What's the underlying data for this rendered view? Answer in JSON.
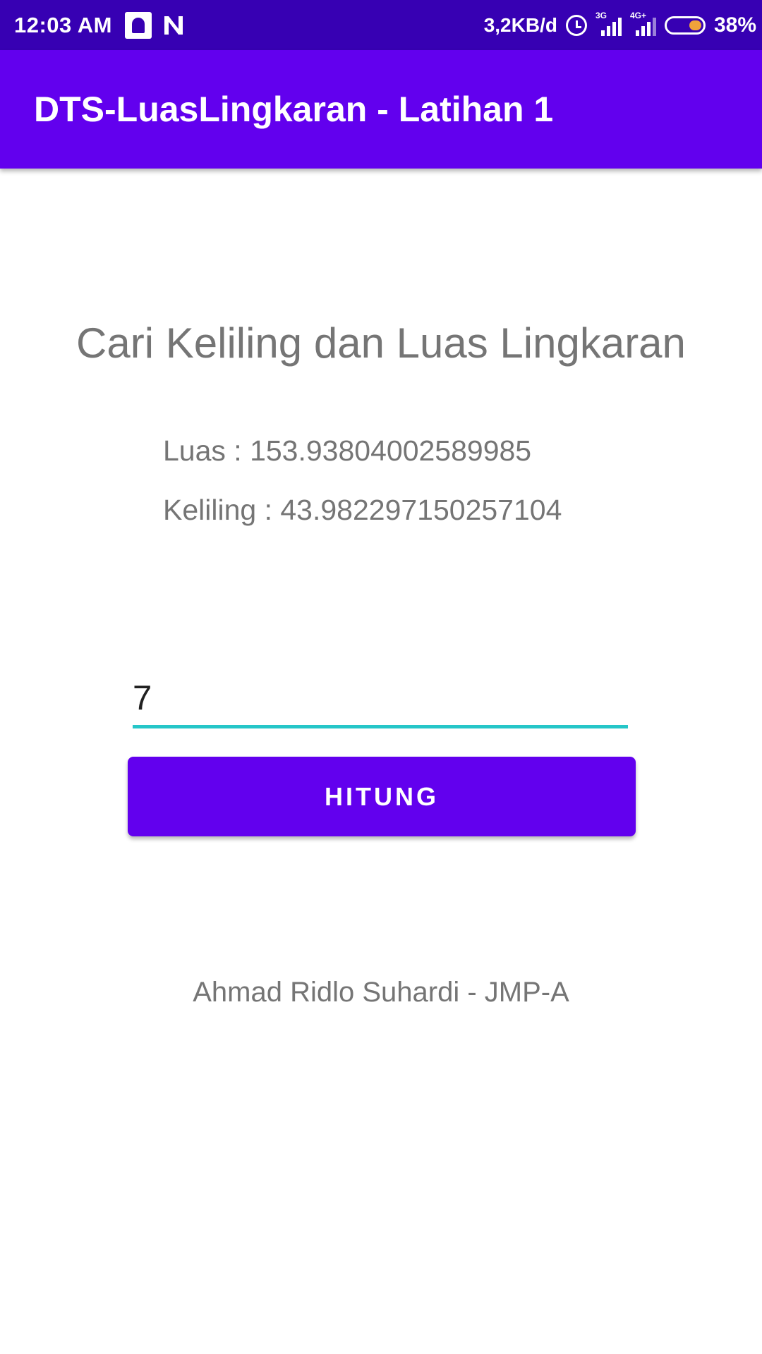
{
  "status_bar": {
    "time": "12:03 AM",
    "left_icons": [
      "mosque-icon",
      "n-icon"
    ],
    "net_speed": "3,2KB/d",
    "alarm_icon": "alarm-icon",
    "signal_1_label": "3G",
    "signal_2_label": "4G+",
    "battery_level": 0.38,
    "battery_percent": "38%",
    "colors": {
      "background": "#3700b3",
      "battery_fill": "#f0a33a"
    }
  },
  "app_bar": {
    "title": "DTS-LuasLingkaran - Latihan 1",
    "color": "#6200ee"
  },
  "main": {
    "heading": "Cari Keliling dan Luas Lingkaran",
    "luas_text": "Luas : 153.93804002589985",
    "keliling_text": "Keliling : 43.982297150257104",
    "radius_input_value": "7",
    "input_underline_color": "#26c6c8",
    "button_label": "HITUNG",
    "button_color": "#6200ee",
    "text_color": "#757575"
  },
  "footer": {
    "credit": "Ahmad Ridlo Suhardi - JMP-A"
  }
}
